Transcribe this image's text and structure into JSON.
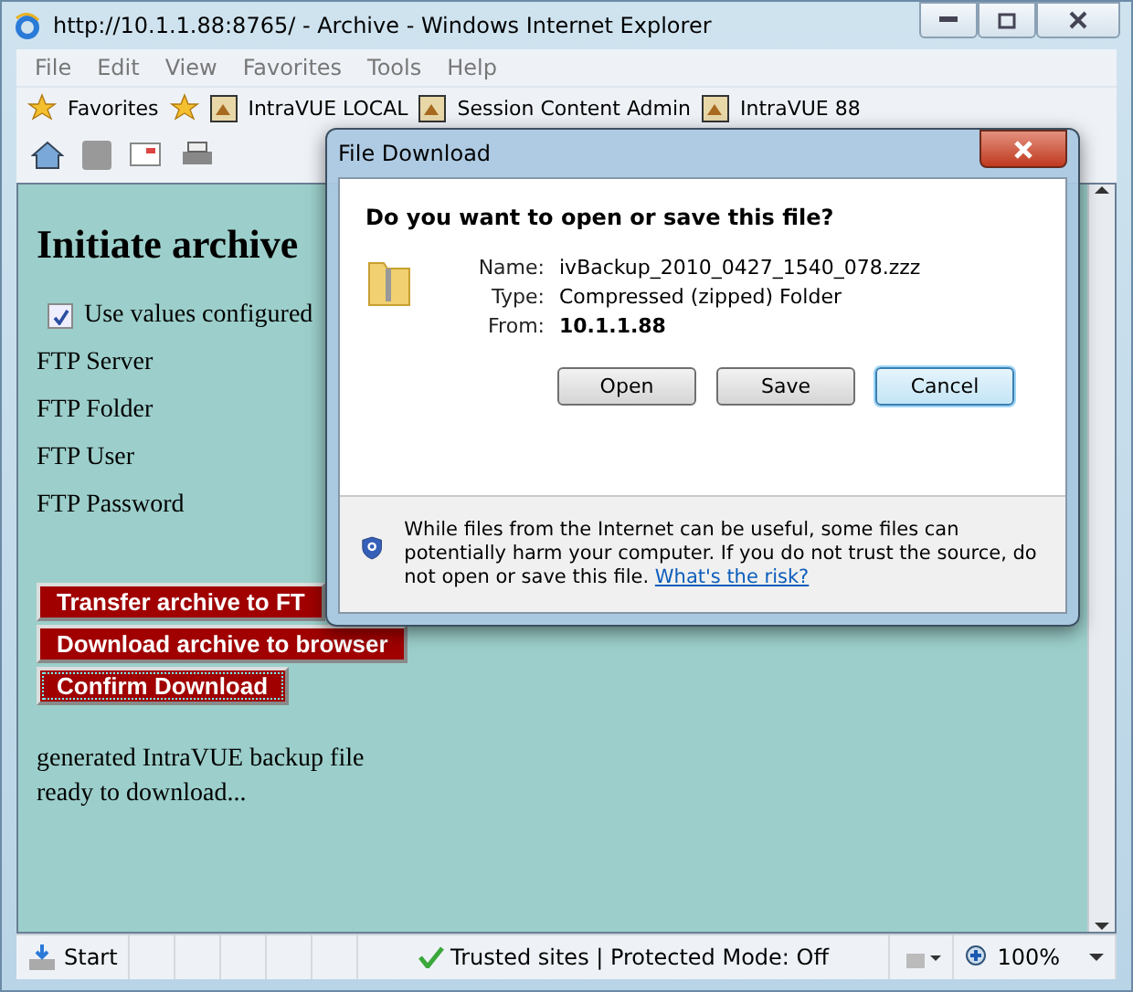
{
  "window": {
    "title": "http://10.1.1.88:8765/ - Archive - Windows Internet Explorer"
  },
  "menu": [
    "File",
    "Edit",
    "View",
    "Favorites",
    "Tools",
    "Help"
  ],
  "favorites_bar": {
    "favorites_label": "Favorites",
    "links": [
      "IntraVUE LOCAL",
      "Session Content Admin",
      "IntraVUE 88"
    ]
  },
  "page": {
    "heading": "Initiate archive",
    "use_values": {
      "label": "Use values configured",
      "checked": true
    },
    "fields": [
      "FTP Server",
      "FTP Folder",
      "FTP User",
      "FTP Password"
    ],
    "buttons": [
      {
        "label": "Transfer archive to FT",
        "focused": false
      },
      {
        "label": "Download archive to browser",
        "focused": false
      },
      {
        "label": "Confirm Download",
        "focused": true
      }
    ],
    "message": [
      "generated IntraVUE backup file",
      "ready to download..."
    ]
  },
  "dialog": {
    "title": "File Download",
    "question": "Do you want to open or save this file?",
    "details": [
      {
        "label": "Name:",
        "value": "ivBackup_2010_0427_1540_078.zzz",
        "bold": false
      },
      {
        "label": "Type:",
        "value": "Compressed (zipped) Folder",
        "bold": false
      },
      {
        "label": "From:",
        "value": "10.1.1.88",
        "bold": true
      }
    ],
    "buttons": [
      {
        "label": "Open",
        "default": false
      },
      {
        "label": "Save",
        "default": false
      },
      {
        "label": "Cancel",
        "default": true
      }
    ],
    "warning": "While files from the Internet can be useful, some files can potentially harm your computer. If you do not trust the source, do not open or save this file.",
    "risk_link": "What's the risk?"
  },
  "status_bar": {
    "left": "Start",
    "zone": "Trusted sites | Protected Mode: Off",
    "zoom": "100%"
  }
}
